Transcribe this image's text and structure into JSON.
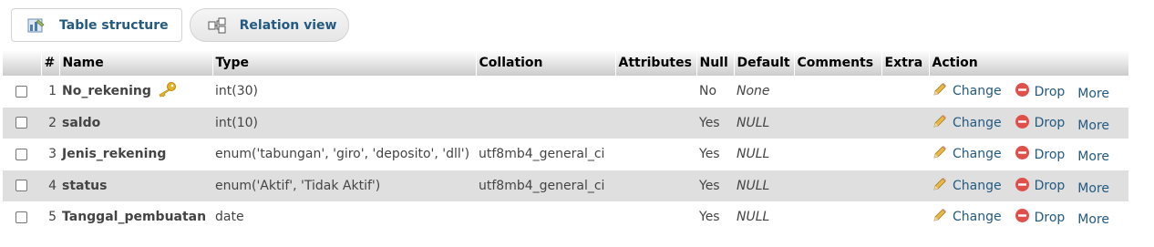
{
  "tabs": [
    {
      "label": "Table structure",
      "icon": "table-structure-icon"
    },
    {
      "label": "Relation view",
      "icon": "relation-view-icon"
    }
  ],
  "columns": [
    "#",
    "Name",
    "Type",
    "Collation",
    "Attributes",
    "Null",
    "Default",
    "Comments",
    "Extra",
    "Action"
  ],
  "rows": [
    {
      "num": "1",
      "name": "No_rekening",
      "primary_key": true,
      "type": "int(30)",
      "collation": "",
      "attributes": "",
      "null": "No",
      "default": "None",
      "comments": "",
      "extra": ""
    },
    {
      "num": "2",
      "name": "saldo",
      "primary_key": false,
      "type": "int(10)",
      "collation": "",
      "attributes": "",
      "null": "Yes",
      "default": "NULL",
      "comments": "",
      "extra": ""
    },
    {
      "num": "3",
      "name": "Jenis_rekening",
      "primary_key": false,
      "type": "enum('tabungan', 'giro', 'deposito', 'dll')",
      "collation": "utf8mb4_general_ci",
      "attributes": "",
      "null": "Yes",
      "default": "NULL",
      "comments": "",
      "extra": ""
    },
    {
      "num": "4",
      "name": "status",
      "primary_key": false,
      "type": "enum('Aktif', 'Tidak Aktif')",
      "collation": "utf8mb4_general_ci",
      "attributes": "",
      "null": "Yes",
      "default": "NULL",
      "comments": "",
      "extra": ""
    },
    {
      "num": "5",
      "name": "Tanggal_pembuatan",
      "primary_key": false,
      "type": "date",
      "collation": "",
      "attributes": "",
      "null": "Yes",
      "default": "NULL",
      "comments": "",
      "extra": ""
    }
  ],
  "actions": {
    "change": "Change",
    "drop": "Drop",
    "more": "More"
  },
  "colors": {
    "link": "#235a81",
    "row_alt": "#dfdfdf",
    "drop_red": "#e0504a",
    "pencil": "#e8b948",
    "key": "#e6b422"
  }
}
